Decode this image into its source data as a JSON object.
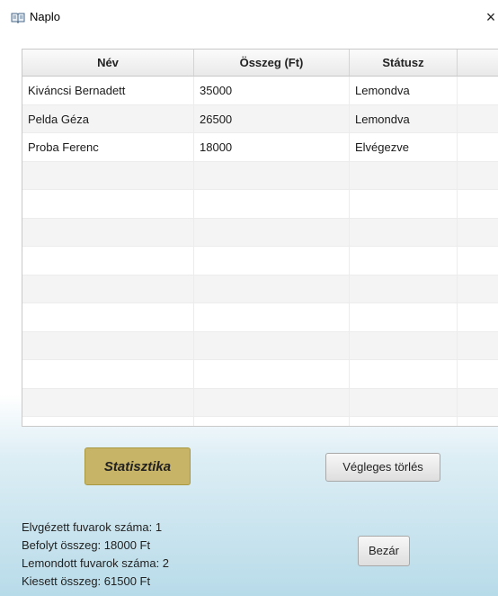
{
  "window": {
    "title": "Naplo",
    "icon": "book-icon",
    "close_glyph": "×"
  },
  "table": {
    "columns": [
      "Név",
      "Összeg (Ft)",
      "Státusz",
      ""
    ],
    "rows": [
      [
        "Kiváncsi Bernadett",
        "35000",
        "Lemondva"
      ],
      [
        "Pelda Géza",
        "26500",
        "Lemondva"
      ],
      [
        "Proba Ferenc",
        "18000",
        "Elvégezve"
      ]
    ],
    "empty_rows": 10
  },
  "buttons": {
    "statisztika": "Statisztika",
    "vegleges_torles": "Végleges törlés",
    "bezar": "Bezár"
  },
  "stats": {
    "line1": "Elvgézett fuvarok száma: 1",
    "line2": "Befolyt összeg: 18000 Ft",
    "line3": "Lemondott fuvarok száma:  2",
    "line4": "Kiesett összeg: 61500 Ft"
  },
  "colors": {
    "stat_button": "#c8b466",
    "background_gradient_end": "#b8dbe9"
  }
}
